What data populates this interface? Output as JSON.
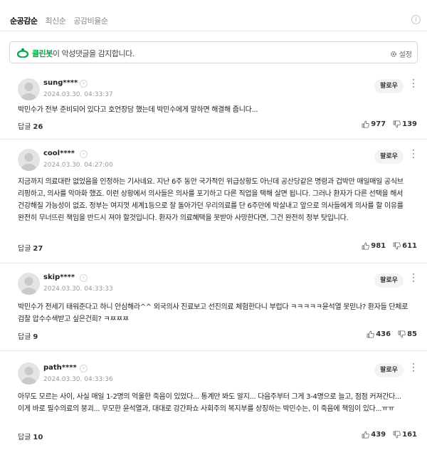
{
  "sort_tabs": [
    "순공감순",
    "최신순",
    "공감비율순"
  ],
  "info_icon": "info-icon",
  "cleanbot": {
    "brand": "클린봇",
    "text": "이 악성댓글을 감지합니다.",
    "setting_label": "설정",
    "brand_color": "#00a842"
  },
  "comments": [
    {
      "user": "sung****",
      "date": "2024.03.30. 04:33:37",
      "follow": "팔로우",
      "body": "박민수가 전부 준비되어 있다고 호언장담 했는데 박민수에게 말하면 해결해 줍니다...",
      "reply_label": "답글",
      "reply_count": "26",
      "likes": "977",
      "dislikes": "139"
    },
    {
      "user": "cool****",
      "date": "2024.03.30. 04:27:00",
      "follow": "팔로우",
      "body": "지금까지 의료대란 없었음을 인정하는 기사네요. 지난 6주 동안 국가적인 위급상황도 아닌데 공산당같은 명령과 겁박만 매일매일 공식브리핑하고, 의사를 악마화 했죠. 이런 상황에서 의사들은 의사를 포기하고 다른 직업을 택해 살면 됩니다. 그러나 환자가 다른 선택을 해서 건강해질 가능성이 없죠. 정부는 여지껏 세계1등으로 잘 돌아가던 우리의료를 단 6주만에 박살내고 앞으로 의사들에게 의사를 할 이유를 완전히 무너뜨린 책임을 반드시 져야 할것입니다. 환자가 의료혜택을 못받아 사망한다면, 그건 완전히 정부 탓입니다.",
      "reply_label": "답글",
      "reply_count": "27",
      "likes": "981",
      "dislikes": "611"
    },
    {
      "user": "skip****",
      "date": "2024.03.30. 04:33:33",
      "follow": "팔로우",
      "body": "박민수가 전세기 태워준다고 하니 안심해라^^ 외국의사 진료보고 선진의료 체험한다니 부럽다 ㅋㅋㅋㅋㅋ윤석열 못믿나? 환자들 단체로 검찰 압수수색받고 싶은건희? ㅋㅉㅉㅉ",
      "reply_label": "답글",
      "reply_count": "9",
      "likes": "436",
      "dislikes": "85"
    },
    {
      "user": "path****",
      "date": "2024.03.30. 04:33:36",
      "follow": "팔로우",
      "body": "아무도 모르는 사이, 사실 매일 1-2명의 억울한 죽음이 있었다... 통계만 봐도 알지... 다음주부터 그게 3-4명으로 늘고, 점점 커져간다... 이게 바로 필수의료의 붕괴... 무모한 윤석열과, 대대로 강간파쇼 사회주의 복지부를 상징하는 박민수는, 이 죽음에 책임이 있다...ㅠㅠ",
      "reply_label": "답글",
      "reply_count": "10",
      "likes": "439",
      "dislikes": "161"
    }
  ]
}
